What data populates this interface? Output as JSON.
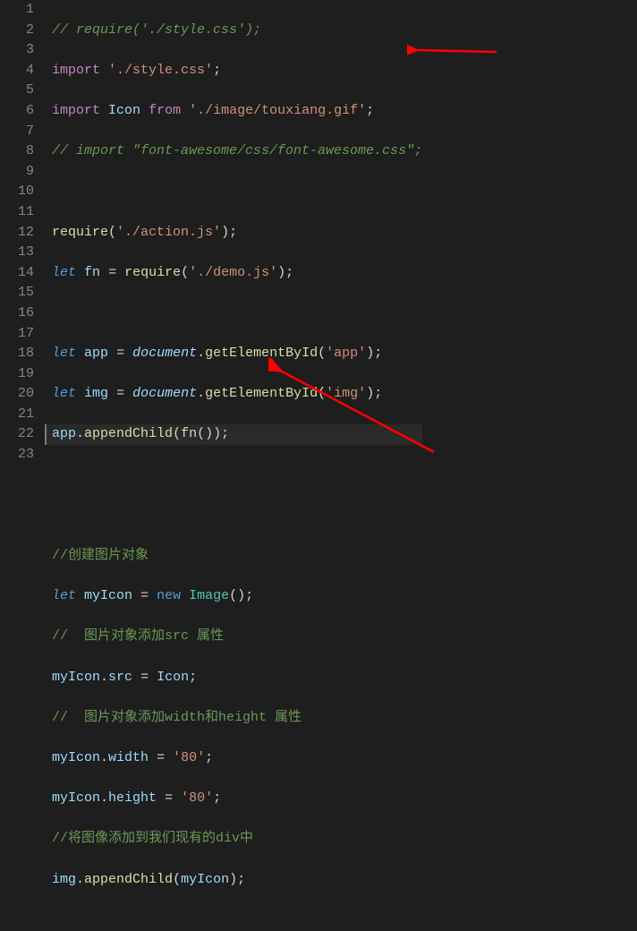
{
  "lineNumbers": [
    "1",
    "2",
    "3",
    "4",
    "5",
    "6",
    "7",
    "8",
    "9",
    "10",
    "11",
    "12",
    "13",
    "14",
    "15",
    "16",
    "17",
    "18",
    "19",
    "20",
    "21",
    "22",
    "23"
  ],
  "code": {
    "l1": "// require('./style.css');",
    "l2_import": "import",
    "l2_str": "'./style.css'",
    "l3_import": "import",
    "l3_icon": "Icon",
    "l3_from": "from",
    "l3_str": "'./image/touxiang.gif'",
    "l4": "// import \"font-awesome/css/font-awesome.css\";",
    "l6_fn": "require",
    "l6_str": "'./action.js'",
    "l7_let": "let",
    "l7_var": "fn",
    "l7_fn": "require",
    "l7_str": "'./demo.js'",
    "l9_let": "let",
    "l9_var": "app",
    "l9_doc": "document",
    "l9_fn": "getElementById",
    "l9_str": "'app'",
    "l10_let": "let",
    "l10_var": "img",
    "l10_doc": "document",
    "l10_fn": "getElementById",
    "l10_str": "'img'",
    "l11_obj": "app",
    "l11_fn": "appendChild",
    "l11_arg": "fn",
    "l14": "//创建图片对象",
    "l15_let": "let",
    "l15_var": "myIcon",
    "l15_new": "new",
    "l15_class": "Image",
    "l16": "//  图片对象添加src 属性",
    "l17_obj": "myIcon",
    "l17_prop": "src",
    "l17_val": "Icon",
    "l18": "//  图片对象添加width和height 属性",
    "l19_obj": "myIcon",
    "l19_prop": "width",
    "l19_val": "'80'",
    "l20_obj": "myIcon",
    "l20_prop": "height",
    "l20_val": "'80'",
    "l21": "//将图像添加到我们现有的div中",
    "l22_obj": "img",
    "l22_fn": "appendChild",
    "l22_arg": "myIcon"
  },
  "colors": {
    "arrow": "#ff0000"
  }
}
